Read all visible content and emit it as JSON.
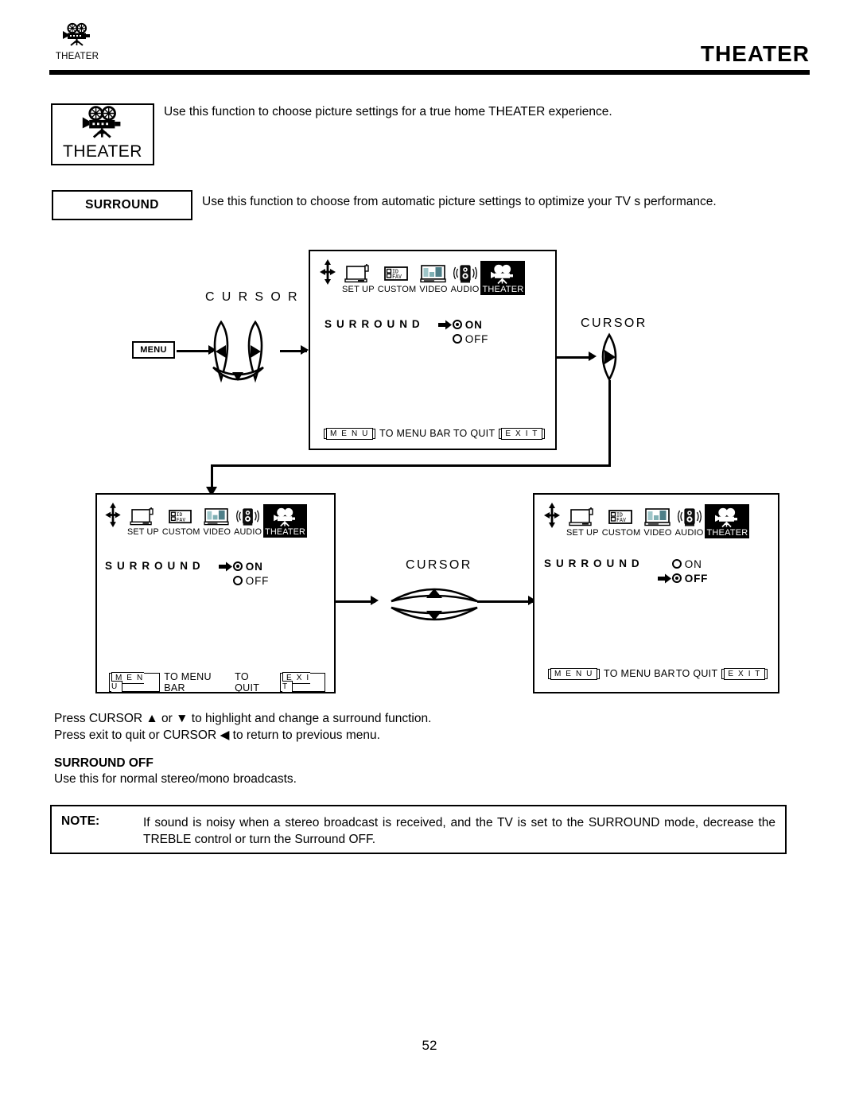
{
  "header": {
    "logo_label": "THEATER",
    "logo_icon": "movie-camera-icon",
    "title": "THEATER"
  },
  "theater_badge": {
    "label": "THEATER",
    "icon": "movie-camera-icon"
  },
  "intro_text": "Use this function to choose picture settings for a true home THEATER experience.",
  "surround_section": {
    "label": "SURROUND",
    "description": "Use this function to choose from automatic picture settings to optimize your TV s performance."
  },
  "menu_bar": {
    "nav_icon": "four-way-arrow-icon",
    "items": [
      {
        "label": "SET UP",
        "icon": "tv-setup-icon",
        "selected": false
      },
      {
        "label": "CUSTOM",
        "icon": "id-fav-icon",
        "selected": false
      },
      {
        "label": "VIDEO",
        "icon": "tv-video-icon",
        "selected": false
      },
      {
        "label": "AUDIO",
        "icon": "speaker-icon",
        "selected": false
      },
      {
        "label": "THEATER",
        "icon": "movie-camera-icon",
        "selected": true
      }
    ]
  },
  "osd_footer": {
    "menu_key": "M E N U",
    "menu_text": "TO MENU BAR",
    "quit_text": "TO QUIT",
    "exit_key": "E X I T"
  },
  "screens": {
    "top": {
      "row_label": "S U R R O U N D",
      "options": [
        {
          "label": "ON",
          "selected": true,
          "pointer": true
        },
        {
          "label": "OFF",
          "selected": false,
          "pointer": false
        }
      ]
    },
    "bottom_left": {
      "row_label": "S U R R O U N D",
      "options": [
        {
          "label": "ON",
          "selected": true,
          "pointer": true
        },
        {
          "label": "OFF",
          "selected": false,
          "pointer": false
        }
      ]
    },
    "bottom_right": {
      "row_label": "S U R R O U N D",
      "options": [
        {
          "label": "ON",
          "selected": false,
          "pointer": false
        },
        {
          "label": "OFF",
          "selected": true,
          "pointer": true
        }
      ]
    }
  },
  "controls": {
    "menu_button": "MENU",
    "cursor_label_left": "C U R S O R",
    "cursor_label_right": "CURSOR",
    "cursor_label_middle": "CURSOR"
  },
  "instructions": {
    "line1_a": "Press CURSOR ",
    "line1_up": "▲",
    "line1_b": " or ",
    "line1_down": "▼",
    "line1_c": " to highlight and change a surround function.",
    "line2_a": "Press exit to quit or CURSOR ",
    "line2_left": "◀",
    "line2_b": " to return to previous menu.",
    "heading": "SURROUND OFF",
    "body": "Use this for normal stereo/mono broadcasts."
  },
  "note": {
    "label": "NOTE:",
    "body": "If sound is noisy when a stereo broadcast is received, and the TV is set to the SURROUND mode, decrease the TREBLE control or turn the Surround OFF."
  },
  "page_number": "52",
  "colors": {
    "ink": "#000000",
    "paper": "#ffffff",
    "selected_tab_bg": "#000000"
  }
}
